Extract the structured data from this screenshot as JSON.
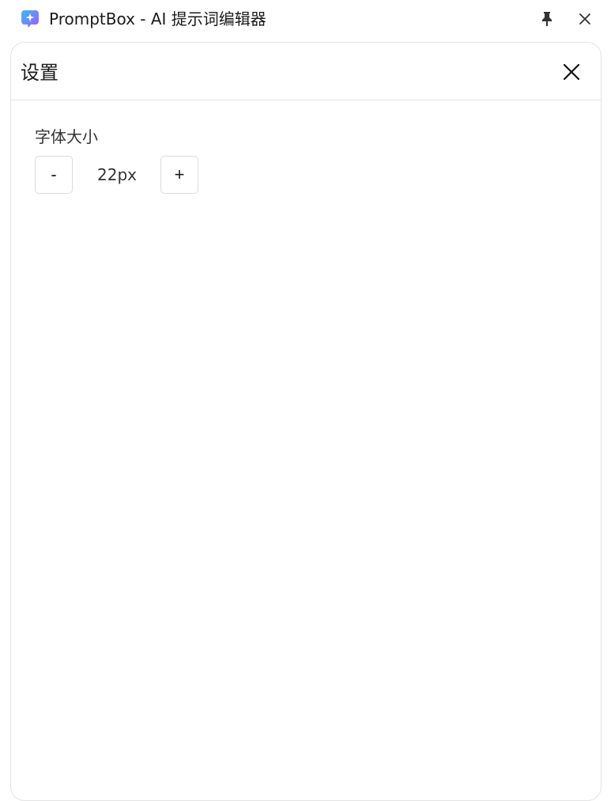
{
  "window": {
    "title": "PromptBox - AI 提示词编辑器",
    "app_icon": "sparkle-chat-icon",
    "pin_icon": "pin-icon",
    "close_icon": "close-icon"
  },
  "settings_panel": {
    "title": "设置",
    "close_icon": "close-icon",
    "font_size": {
      "label": "字体大小",
      "decrease_label": "-",
      "value": "22px",
      "increase_label": "+"
    }
  },
  "colors": {
    "background": "#ffffff",
    "border": "#e3e3e3",
    "text": "#1a1a1a",
    "icon_gradient_start": "#3b82f6",
    "icon_gradient_end": "#a855f7"
  }
}
